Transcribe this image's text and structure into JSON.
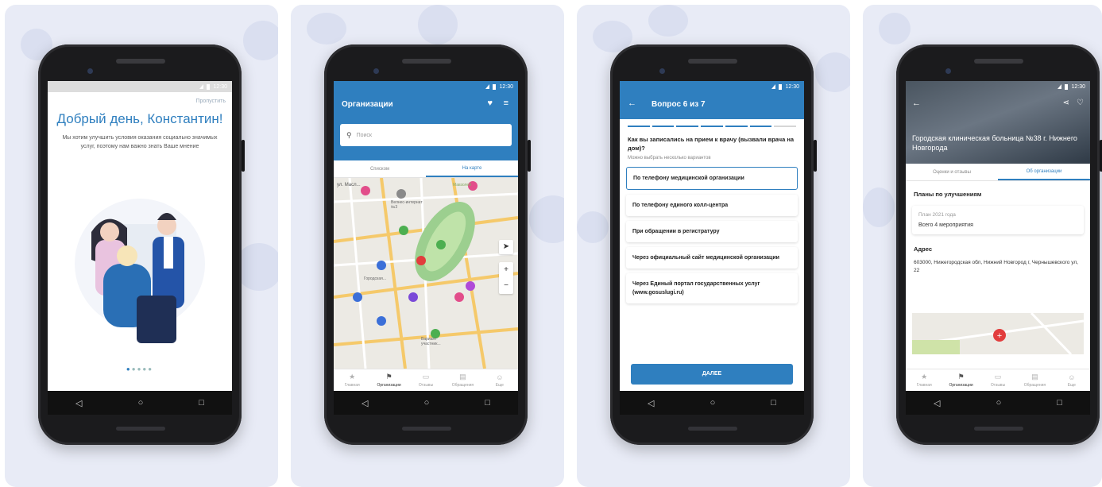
{
  "status_time": "12:30",
  "screen1": {
    "skip": "Пропустить",
    "greeting": "Добрый день, Константин!",
    "body": "Мы хотим улучшить условия оказания социально значимых услуг, поэтому нам важно знать Ваше мнение"
  },
  "screen2": {
    "title": "Организации",
    "search_placeholder": "Поиск",
    "tabs": [
      "Списком",
      "На карте"
    ],
    "map_labels": [
      "ул. Масл...",
      "Велнес-интернат №3",
      "Мавзолей",
      "Раритет",
      "Вход",
      "Пожарная...",
      "Гимназия",
      "Детская...",
      "Городская...",
      "Вход...",
      "Вариант участник..."
    ]
  },
  "screen3": {
    "title": "Вопрос 6 из 7",
    "question": "Как вы записались на прием к врачу (вызвали врача на дом)?",
    "hint": "Можно выбрать несколько вариантов",
    "options": [
      "По телефону медицинской организации",
      "По телефону единого колл-центра",
      "При обращении в регистратуру",
      "Через официальный сайт медицинской организации",
      "Через Единый портал государственных услуг (www.gosuslugi.ru)"
    ],
    "next_button": "ДАЛЕЕ"
  },
  "screen4": {
    "org_name": "Городская клиническая больница №38 г. Нижнего Новгорода",
    "tabs": [
      "Оценки и отзывы",
      "Об организации"
    ],
    "plans_heading": "Планы по улучшениям",
    "plan_title": "План 2021 года",
    "plan_count": "Всего 4 мероприятия",
    "address_heading": "Адрес",
    "address": "603000, Нижегородская обл, Нижний Новгород г, Чернышевского ул, 22"
  },
  "bottom_tabs": [
    "Главная",
    "Организации",
    "Отзывы",
    "Обращения",
    "Еще"
  ],
  "accent_color": "#2f7fbf"
}
